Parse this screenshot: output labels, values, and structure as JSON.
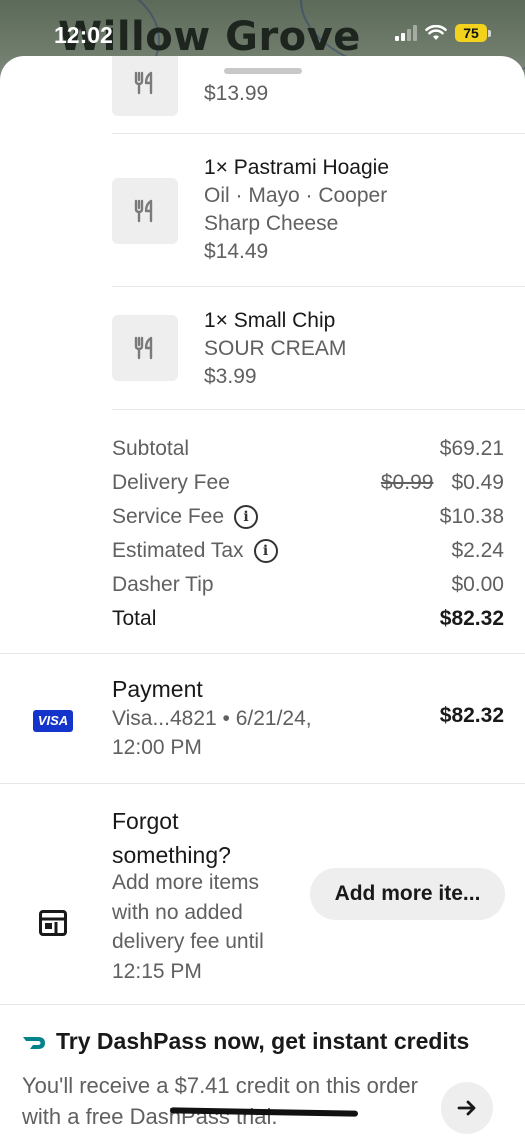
{
  "status_bar": {
    "time": "12:02",
    "battery": "75"
  },
  "map": {
    "label": "Willow Grove"
  },
  "items": [
    {
      "name": "",
      "options": "",
      "price": "$13.99"
    },
    {
      "name": "1× Pastrami Hoagie",
      "options": "Oil · Mayo · Cooper Sharp Cheese",
      "price": "$14.49"
    },
    {
      "name": "1× Small Chip",
      "options": "SOUR CREAM",
      "price": "$3.99"
    }
  ],
  "summary": {
    "subtotal_label": "Subtotal",
    "subtotal": "$69.21",
    "delivery_label": "Delivery Fee",
    "delivery_original": "$0.99",
    "delivery": "$0.49",
    "service_label": "Service Fee",
    "service": "$10.38",
    "tax_label": "Estimated Tax",
    "tax": "$2.24",
    "tip_label": "Dasher Tip",
    "tip": "$0.00",
    "total_label": "Total",
    "total": "$82.32"
  },
  "payment": {
    "title": "Payment",
    "card_brand": "VISA",
    "detail": "Visa...4821 • 6/21/24, 12:00 PM",
    "amount": "$82.32"
  },
  "forgot": {
    "title": "Forgot something?",
    "description": "Add more items with no added delivery fee until 12:15 PM",
    "button": "Add more ite..."
  },
  "dashpass": {
    "title": "Try DashPass now, get instant credits",
    "description": "You'll receive a $7.41 credit on this order with a free DashPass trial."
  },
  "colors": {
    "visa_blue": "#1434cb",
    "dashpass_teal": "#00838a",
    "battery_yellow": "#f2d21c"
  }
}
